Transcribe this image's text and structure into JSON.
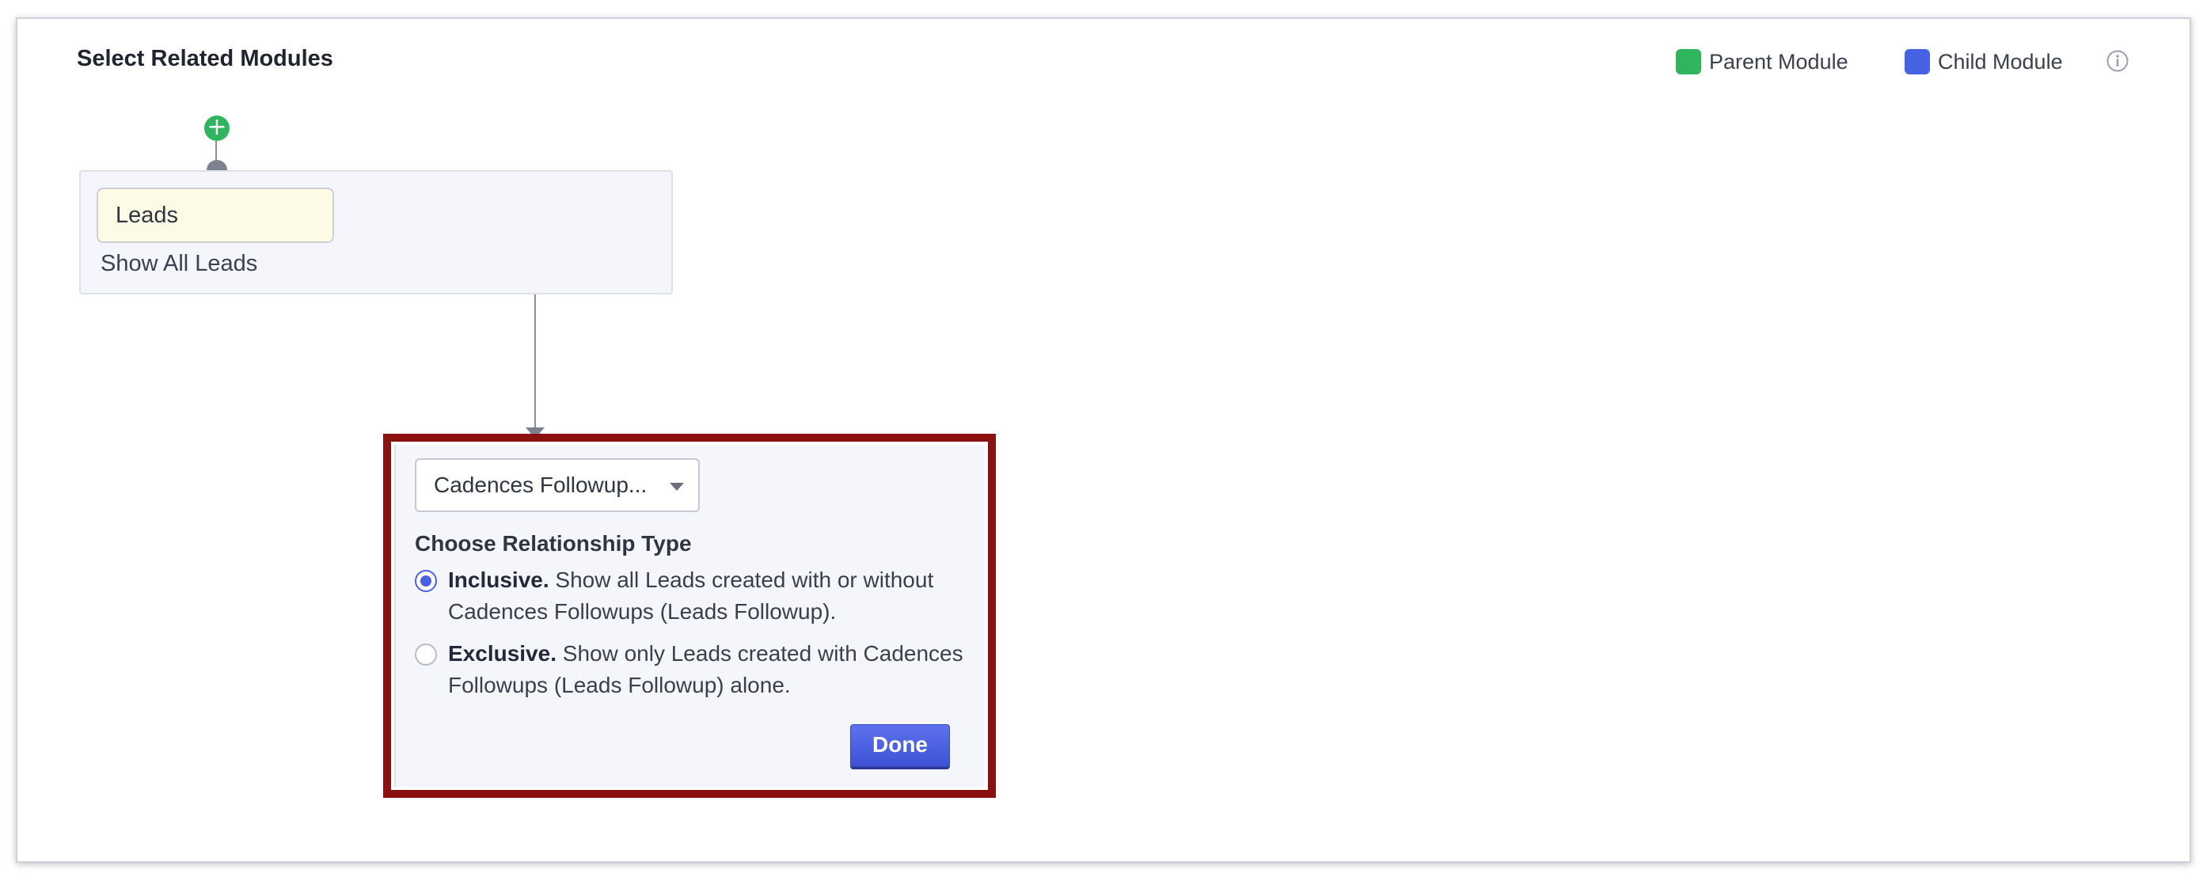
{
  "header": {
    "title": "Select Related Modules"
  },
  "legend": {
    "parent_label": "Parent Module",
    "parent_color": "#2fb55d",
    "child_label": "Child Module",
    "child_color": "#4763e4",
    "info_icon": "info-icon"
  },
  "parent_module": {
    "add_icon": "plus-icon",
    "name": "Leads",
    "link_text": "Show All Leads"
  },
  "child_module": {
    "selected_module": "Cadences Followup...",
    "relationship_heading": "Choose Relationship Type",
    "options": [
      {
        "title": "Inclusive.",
        "description": "Show all Leads created with or without Cadences Followups (Leads Followup).",
        "selected": true
      },
      {
        "title": "Exclusive.",
        "description": "Show only Leads created with Cadences Followups (Leads Followup) alone.",
        "selected": false
      }
    ],
    "done_label": "Done",
    "highlight_color": "#8b1010"
  }
}
